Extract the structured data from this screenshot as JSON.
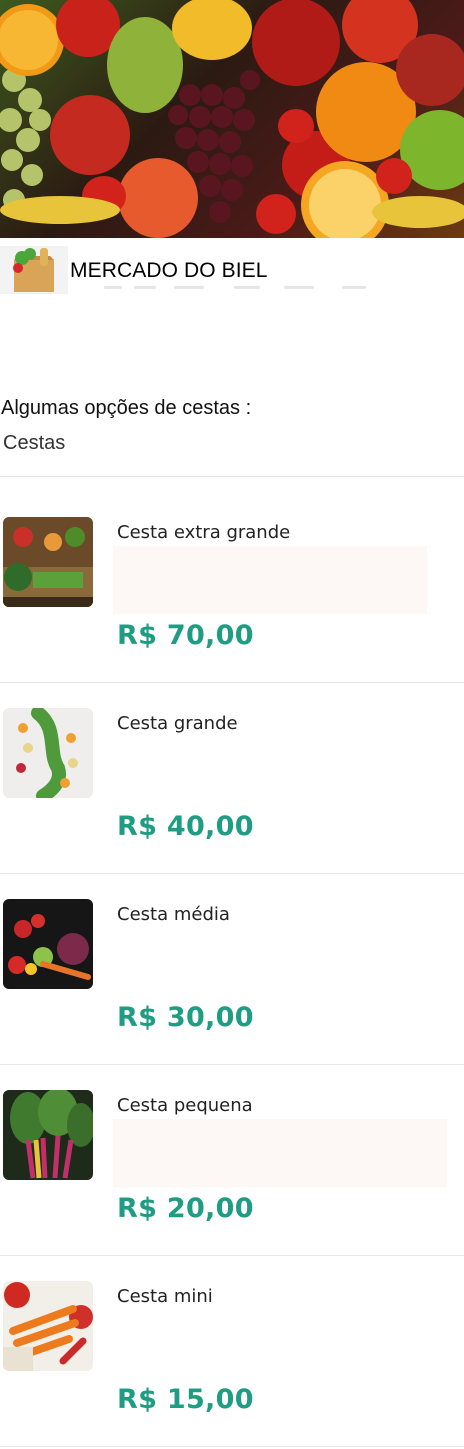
{
  "hero": {
    "image": "mixed-fruits-photo"
  },
  "brand": {
    "logo_icon": "grocery-bag-icon",
    "name": "MERCADO DO BIEL"
  },
  "intro_text": "Algumas opções de cestas :",
  "section_title": "Cestas",
  "colors": {
    "price": "#1f9d82",
    "divider": "#e6e6e6"
  },
  "products": [
    {
      "name": "Cesta extra grande",
      "price": "R$ 70,00",
      "image": "vegetable-market-crates-photo"
    },
    {
      "name": "Cesta grande",
      "price": "R$ 40,00",
      "image": "sliced-vegetables-photo"
    },
    {
      "name": "Cesta média",
      "price": "R$ 30,00",
      "image": "vegetables-dark-background-photo"
    },
    {
      "name": "Cesta pequena",
      "price": "R$ 20,00",
      "image": "chard-leaves-photo"
    },
    {
      "name": "Cesta mini",
      "price": "R$ 15,00",
      "image": "carrots-tomatoes-photo"
    }
  ]
}
